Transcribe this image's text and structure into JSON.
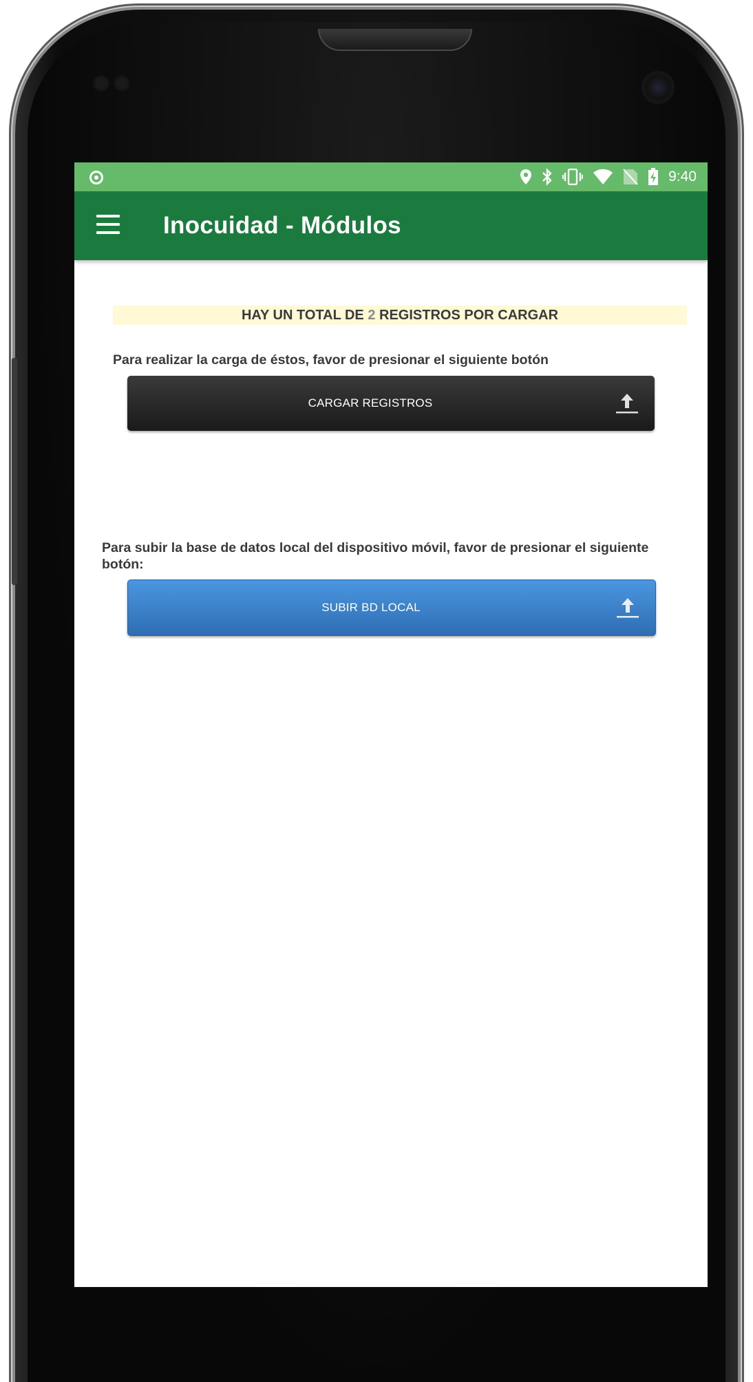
{
  "status_bar": {
    "time": "9:40",
    "icons": [
      "record-icon",
      "location-icon",
      "bluetooth-icon",
      "vibrate-icon",
      "wifi-icon",
      "no-sim-icon",
      "battery-charging-icon"
    ]
  },
  "app_bar": {
    "title": "Inocuidad - Módulos",
    "menu_icon": "hamburger-menu-icon"
  },
  "banner": {
    "prefix": "HAY UN TOTAL DE ",
    "count": "2",
    "suffix": " REGISTROS POR CARGAR"
  },
  "upload_records": {
    "description": "Para realizar la carga de éstos, favor de presionar el siguiente botón",
    "button_label": "CARGAR REGISTROS",
    "icon": "upload-icon"
  },
  "upload_db": {
    "description": "Para subir la base de datos local del dispositivo móvil, favor de presionar el siguiente botón:",
    "button_label": "SUBIR BD LOCAL",
    "icon": "upload-icon"
  },
  "colors": {
    "status_bar": "#66bb6a",
    "app_bar": "#1b7a3e",
    "banner_bg": "#fff9d6",
    "dark_button": "#1f1f1f",
    "blue_button": "#3b82cc"
  }
}
